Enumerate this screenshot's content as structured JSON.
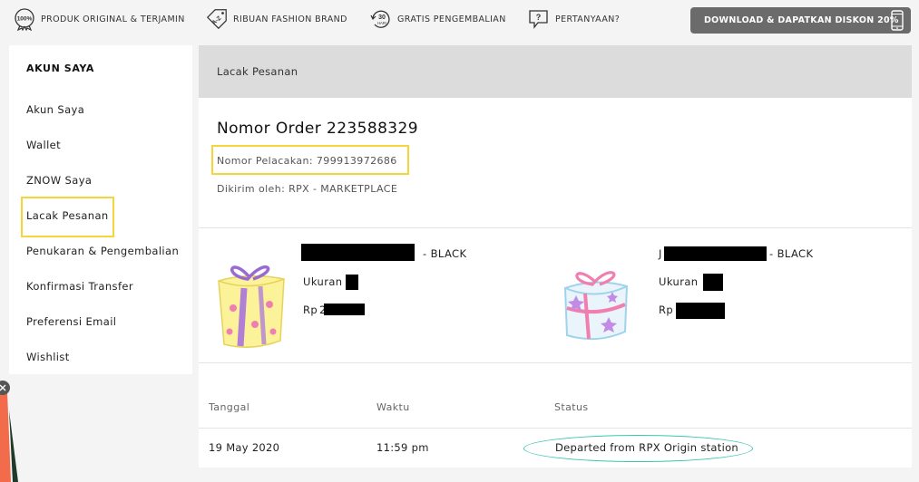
{
  "topbar": {
    "usps": [
      {
        "icon": "badge-100-icon",
        "label": "PRODUK ORIGINAL & TERJAMIN"
      },
      {
        "icon": "tag-az-icon",
        "label": "RIBUAN FASHION BRAND"
      },
      {
        "icon": "return-30-icon",
        "label": "GRATIS PENGEMBALIAN"
      },
      {
        "icon": "question-bubble-icon",
        "label": "PERTANYAAN?"
      }
    ],
    "badge_text": "100%",
    "tag_text": "A-Z",
    "return_days": "30",
    "return_unit": "HARI",
    "download_label": "DOWNLOAD & DAPATKAN DISKON 20%"
  },
  "sidebar": {
    "title": "AKUN SAYA",
    "items": [
      {
        "label": "Akun Saya"
      },
      {
        "label": "Wallet"
      },
      {
        "label": "ZNOW Saya"
      },
      {
        "label": "Lacak Pesanan",
        "active": true
      },
      {
        "label": "Penukaran & Pengembalian"
      },
      {
        "label": "Konfirmasi Transfer"
      },
      {
        "label": "Preferensi Email"
      },
      {
        "label": "Wishlist"
      }
    ]
  },
  "main": {
    "breadcrumb": "Lacak Pesanan",
    "order_title": "Nomor Order 223588329",
    "tracking": "Nomor Pelacakan: 799913972686",
    "shipper": "Dikirim oleh: RPX - MARKETPLACE",
    "products": [
      {
        "name_prefix": "",
        "name_suffix": "- BLACK",
        "size_label": "Ukuran",
        "size_prefix": "",
        "price_label": "Rp",
        "price_prefix": "2"
      },
      {
        "name_prefix": "J",
        "name_suffix": "- BLACK",
        "size_label": "Ukuran",
        "size_prefix": "",
        "price_label": "Rp",
        "price_prefix": ""
      }
    ],
    "table": {
      "headers": {
        "date": "Tanggal",
        "time": "Waktu",
        "status": "Status"
      },
      "rows": [
        {
          "date": "19 May 2020",
          "time": "11:59 pm",
          "status": "Departed from RPX Origin station"
        }
      ]
    }
  },
  "colors": {
    "highlight": "#f6d53a",
    "status_circle": "#3cc7b1",
    "download_button": "#6b6b6b",
    "widget_orange": "#f26b4a"
  }
}
